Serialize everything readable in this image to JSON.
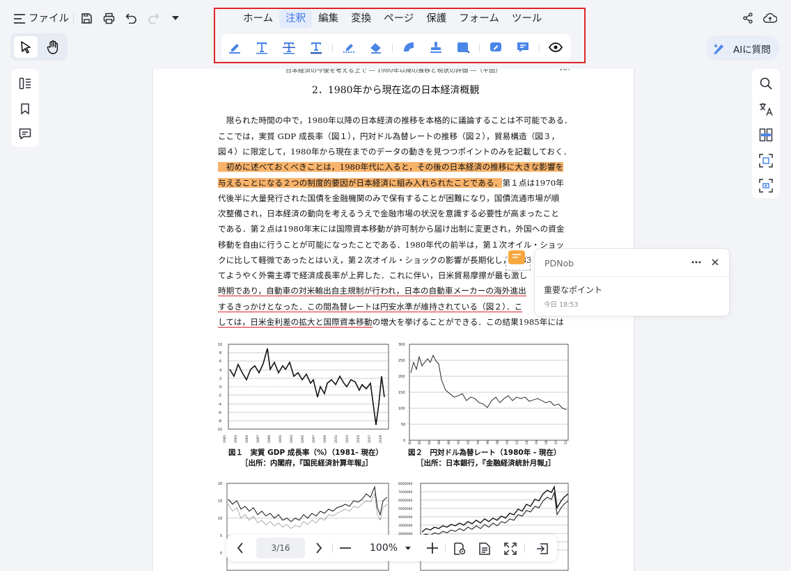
{
  "titlebar": {
    "file_label": "ファイル"
  },
  "menu": {
    "tabs": [
      {
        "label": "ホーム",
        "active": false
      },
      {
        "label": "注釈",
        "active": true
      },
      {
        "label": "編集",
        "active": false
      },
      {
        "label": "変換",
        "active": false
      },
      {
        "label": "ページ",
        "active": false
      },
      {
        "label": "保護",
        "active": false
      },
      {
        "label": "フォーム",
        "active": false
      },
      {
        "label": "ツール",
        "active": false
      }
    ]
  },
  "annotation_tools": [
    "highlight-icon",
    "text-icon",
    "strikethrough-icon",
    "underline-icon",
    "area-highlight-icon",
    "eraser-icon",
    "shape-icon",
    "stamp-icon",
    "text-box-icon",
    "sign-icon",
    "note-icon",
    "eye-icon"
  ],
  "ai": {
    "label": "AIに質問"
  },
  "document": {
    "running_header": "日本経済の今後を考える上で ― 1980年以降の推移と現状の評価 ―（平田）",
    "page_number": "187",
    "section_title": "2．1980年から現在迄の日本経済概観",
    "lines": [
      "　限られた時間の中で，1980年以降の日本経済の推移を本格的に議論することは不可能である．",
      "ここでは，実質 GDP 成長率（図１），円対ドル為替レートの推移（図２），貿易構造（図３，",
      "図４）に限定して，1980年から現在までのデータの動きを見つつポイントのみを記載しておく．",
      "　初めに述べておくべきことは，1980年代に入ると，その後の日本経済の推移に大きな影響を",
      "与えることになる２つの制度的要因が日本経済に組み入れられたことである．",
      "第１点は1970年",
      "代後半に大量発行された国債を金融機関のみで保有することが困難になり，国債流通市場が順",
      "次整備され，日本経済の動向を考えるうえで金融市場の状況を意識する必要性が高まったこと",
      "である．第２点は1980年末には国際資本移動が許可制から届け出制に変更され，外国への資金",
      "移動を自由に行うことが可能になったことである．1980年代の前半は，第１次オイル・ショッ",
      "クに比して軽微であったとはいえ，第２次オイル・ショックの影響が長期化し，1983",
      "てようやく外需主導で経済成長率が上昇した．これに伴い，日米貿易摩擦が最も激し",
      "時期であり，自動車の対米輸出自主規制が行われ，日本の自動車メーカーの海外進出",
      "するきっかけとなった．この間為替レートは円安水準が維持されている（図２）．こ",
      "しては，日米金利差の拡大と国際資本移動",
      "の増大を挙げることができる．この結果1985年には"
    ],
    "fig1_caption": "図１　実質 GDP 成長率（%）（1981- 現在）",
    "fig1_source": "［出所：内閣府，『国民経済計算年報』］",
    "fig2_caption": "図２　円対ドル為替レート（1980年 - 現在）",
    "fig2_source": "［出所：日本銀行，『金融経済統計月報』］",
    "fig1_yticks": [
      "10",
      "8",
      "6",
      "4",
      "2",
      "0",
      "-2",
      "-4",
      "-6",
      "-8",
      "-10"
    ],
    "fig1_xticks": [
      "1981",
      "1983",
      "1985",
      "1987",
      "1989",
      "1991",
      "1993",
      "1995",
      "1997",
      "1999",
      "2001",
      "2003",
      "2005",
      "2007",
      "2009"
    ],
    "fig2_yticks": [
      "300",
      "250",
      "200",
      "150",
      "100",
      "50",
      "0"
    ],
    "fig2_xticks": [
      "80",
      "82",
      "84",
      "86",
      "88",
      "90",
      "92",
      "94",
      "96",
      "98",
      "00",
      "02",
      "04",
      "06",
      "08",
      "10",
      "12"
    ],
    "fig3_yticks": [
      "20",
      "15",
      "10",
      "5",
      "0"
    ],
    "fig4_yticks": [
      "8000000",
      "7000000",
      "6000000",
      "5000000",
      "4000000",
      "3000000",
      "2000000",
      "1000000",
      "0"
    ]
  },
  "comment": {
    "author": "PDNob",
    "text": "重要なポイント",
    "time": "今日 18:53"
  },
  "footer": {
    "page_indicator": "3/16",
    "zoom": "100%"
  }
}
